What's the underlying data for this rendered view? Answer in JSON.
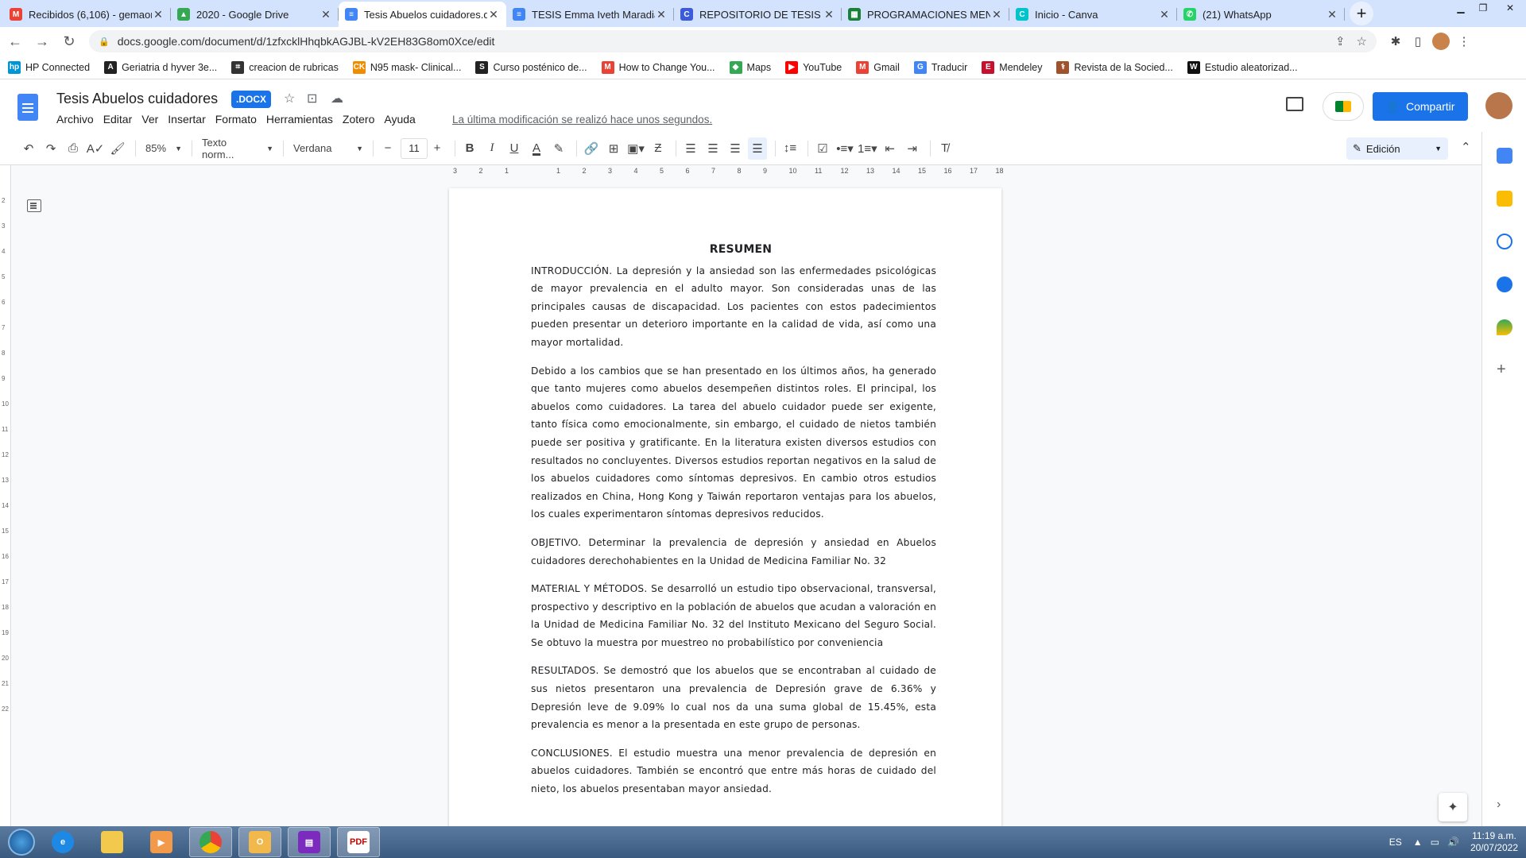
{
  "tabs": [
    {
      "label": "Recibidos (6,106) - gemaor",
      "icon": "M",
      "color": "#ea4335"
    },
    {
      "label": "2020 - Google Drive",
      "icon": "▲",
      "color": "#34a853"
    },
    {
      "label": "Tesis Abuelos cuidadores.do",
      "icon": "≡",
      "color": "#4285f4",
      "active": true
    },
    {
      "label": "TESIS Emma Iveth Maradiag",
      "icon": "≡",
      "color": "#4285f4"
    },
    {
      "label": "REPOSITORIO DE TESIS UM",
      "icon": "C",
      "color": "#3b5bdb"
    },
    {
      "label": "PROGRAMACIONES MENSU",
      "icon": "▦",
      "color": "#188038"
    },
    {
      "label": "Inicio - Canva",
      "icon": "C",
      "color": "#00c4cc"
    },
    {
      "label": "(21) WhatsApp",
      "icon": "✆",
      "color": "#25d366"
    }
  ],
  "browser": {
    "url": "docs.google.com/document/d/1zfxcklHhqbkAGJBL-kV2EH83G8om0Xce/edit"
  },
  "bookmarks": [
    {
      "label": "HP Connected",
      "icon": "hp",
      "color": "#0096d6"
    },
    {
      "label": "Geriatria d hyver 3e...",
      "icon": "A",
      "color": "#222"
    },
    {
      "label": "creacion de rubricas",
      "icon": "⌗",
      "color": "#333"
    },
    {
      "label": "N95 mask- Clinical...",
      "icon": "CK",
      "color": "#f08c00"
    },
    {
      "label": "Curso posténico de...",
      "icon": "S",
      "color": "#222"
    },
    {
      "label": "How to Change You...",
      "icon": "M",
      "color": "#ea4335"
    },
    {
      "label": "Maps",
      "icon": "◆",
      "color": "#34a853"
    },
    {
      "label": "YouTube",
      "icon": "▶",
      "color": "#ff0000"
    },
    {
      "label": "Gmail",
      "icon": "M",
      "color": "#ea4335"
    },
    {
      "label": "Traducir",
      "icon": "G",
      "color": "#4285f4"
    },
    {
      "label": "Mendeley",
      "icon": "E",
      "color": "#c8102e"
    },
    {
      "label": "Revista de la Socied...",
      "icon": "⚕",
      "color": "#a0522d"
    },
    {
      "label": "Estudio aleatorizad...",
      "icon": "W",
      "color": "#111"
    }
  ],
  "doc": {
    "title": "Tesis Abuelos cuidadores",
    "badge": ".DOCX",
    "last_edit": "La última modificación se realizó hace unos segundos.",
    "menu": [
      "Archivo",
      "Editar",
      "Ver",
      "Insertar",
      "Formato",
      "Herramientas",
      "Zotero",
      "Ayuda"
    ],
    "share_label": "Compartir",
    "zoom": "85%",
    "style": "Texto norm...",
    "font": "Verdana",
    "font_size": "11",
    "mode": "Edición"
  },
  "content": {
    "heading": "RESUMEN",
    "paragraphs": [
      "INTRODUCCIÓN. La depresión y la ansiedad son las enfermedades psicológicas de mayor prevalencia en el adulto mayor. Son consideradas unas de las principales causas de discapacidad. Los pacientes con estos padecimientos pueden presentar un deterioro importante en la calidad de vida, así como una mayor mortalidad.",
      "Debido a los cambios que se han presentado en los últimos años, ha generado que tanto mujeres como abuelos desempeñen distintos roles. El principal, los abuelos como cuidadores. La tarea del abuelo cuidador puede ser exigente, tanto física como emocionalmente, sin embargo, el cuidado de nietos también puede ser positiva y gratificante. En la literatura existen diversos estudios con resultados no concluyentes. Diversos estudios reportan negativos en la salud de los abuelos cuidadores como síntomas depresivos. En cambio otros estudios realizados en China, Hong Kong y Taiwán reportaron ventajas para los abuelos, los cuales experimentaron síntomas depresivos reducidos.",
      "OBJETIVO. Determinar la prevalencia de depresión y ansiedad en Abuelos cuidadores derechohabientes en la Unidad de Medicina Familiar No. 32",
      "MATERIAL Y MÉTODOS. Se desarrolló un estudio tipo observacional, transversal, prospectivo y descriptivo en la población de abuelos que acudan a valoración en la Unidad de Medicina Familiar No. 32 del Instituto Mexicano del Seguro Social. Se obtuvo la muestra por muestreo no probabilístico por conveniencia",
      "RESULTADOS. Se demostró que los abuelos que se encontraban al cuidado de sus nietos presentaron una prevalencia de Depresión grave de 6.36% y Depresión leve de 9.09% lo cual nos da una suma global de 15.45%, esta prevalencia es menor a la presentada en este grupo de personas.",
      "CONCLUSIONES. El estudio muestra una menor prevalencia de depresión en abuelos cuidadores. También se encontró que entre más horas de cuidado del nieto, los abuelos presentaban mayor ansiedad."
    ]
  },
  "taskbar": {
    "lang": "ES",
    "time": "11:19 a.m.",
    "date": "20/07/2022"
  }
}
